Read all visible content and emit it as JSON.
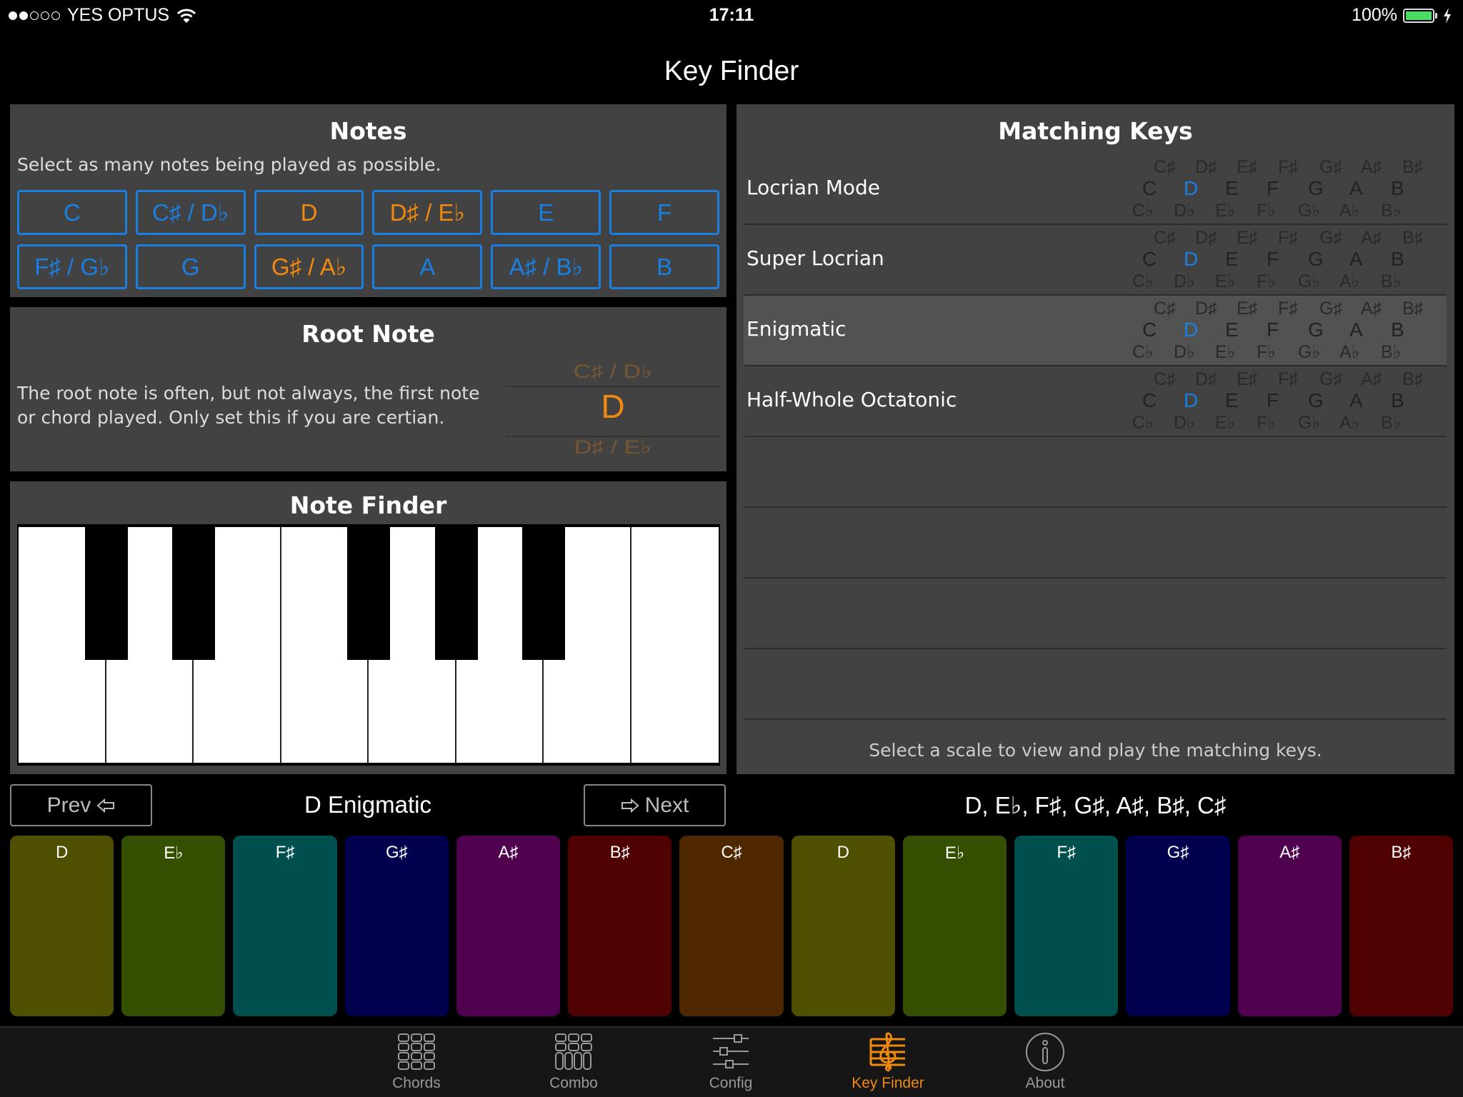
{
  "status_bar": {
    "signal_dots_filled": 2,
    "signal_dots_total": 5,
    "carrier": "YES OPTUS",
    "time": "17:11",
    "battery_percent": "100%",
    "battery_level": 1.0,
    "wifi_icon": "wifi-icon",
    "charging_icon": "bolt-icon"
  },
  "page_title": "Key Finder",
  "notes_panel": {
    "title": "Notes",
    "hint": "Select as many notes being played as possible.",
    "buttons": [
      {
        "label": "C",
        "selected": false
      },
      {
        "label": "C♯ / D♭",
        "selected": false
      },
      {
        "label": "D",
        "selected": true
      },
      {
        "label": "D♯ / E♭",
        "selected": true
      },
      {
        "label": "E",
        "selected": false
      },
      {
        "label": "F",
        "selected": false
      },
      {
        "label": "F♯ / G♭",
        "selected": false
      },
      {
        "label": "G",
        "selected": false
      },
      {
        "label": "G♯ / A♭",
        "selected": true
      },
      {
        "label": "A",
        "selected": false
      },
      {
        "label": "A♯ / B♭",
        "selected": false
      },
      {
        "label": "B",
        "selected": false
      }
    ]
  },
  "root_panel": {
    "title": "Root Note",
    "description": "The root note is often, but not always, the first note or chord played. Only set this if you are certian.",
    "picker": {
      "previous": "C♯ / D♭",
      "selected": "D",
      "next": "D♯ / E♭"
    }
  },
  "note_finder": {
    "title": "Note Finder",
    "white_keys": 8,
    "black_keys": 5
  },
  "matching_keys": {
    "title": "Matching Keys",
    "sharps": [
      "C♯",
      "D♯",
      "E♯",
      "F♯",
      "G♯",
      "A♯",
      "B♯"
    ],
    "naturals": [
      "C",
      "D",
      "E",
      "F",
      "G",
      "A",
      "B"
    ],
    "flats": [
      "C♭",
      "D♭",
      "E♭",
      "F♭",
      "G♭",
      "A♭",
      "B♭"
    ],
    "highlighted_natural": "D",
    "rows": [
      {
        "name": "Locrian Mode",
        "selected": false
      },
      {
        "name": "Super Locrian",
        "selected": false
      },
      {
        "name": "Enigmatic",
        "selected": true
      },
      {
        "name": "Half-Whole Octatonic",
        "selected": false
      }
    ],
    "empty_rows": 4,
    "hint": "Select a scale to view and play the matching keys."
  },
  "scale_nav": {
    "prev_label": "Prev",
    "prev_icon": "arrow-left-icon",
    "next_label": "Next",
    "next_icon": "arrow-right-icon",
    "scale_name": "D Enigmatic",
    "scale_notes": "D, E♭, F♯, G♯, A♯, B♯, C♯"
  },
  "pads": [
    {
      "label": "D",
      "color": "#4f4f00"
    },
    {
      "label": "E♭",
      "color": "#354f00"
    },
    {
      "label": "F♯",
      "color": "#004f4f"
    },
    {
      "label": "G♯",
      "color": "#00004f"
    },
    {
      "label": "A♯",
      "color": "#4f004f"
    },
    {
      "label": "B♯",
      "color": "#4f0000"
    },
    {
      "label": "C♯",
      "color": "#4f2800"
    },
    {
      "label": "D",
      "color": "#4f4f00"
    },
    {
      "label": "E♭",
      "color": "#354f00"
    },
    {
      "label": "F♯",
      "color": "#004f4f"
    },
    {
      "label": "G♯",
      "color": "#00004f"
    },
    {
      "label": "A♯",
      "color": "#4f004f"
    },
    {
      "label": "B♯",
      "color": "#4f0000"
    }
  ],
  "tabs": [
    {
      "label": "Chords",
      "icon": "chords-grid-icon",
      "active": false
    },
    {
      "label": "Combo",
      "icon": "combo-grid-icon",
      "active": false
    },
    {
      "label": "Config",
      "icon": "sliders-icon",
      "active": false
    },
    {
      "label": "Key Finder",
      "icon": "treble-clef-icon",
      "active": true
    },
    {
      "label": "About",
      "icon": "info-icon",
      "active": false
    }
  ],
  "colors": {
    "accent_blue": "#1a7fe0",
    "accent_orange": "#f0890f",
    "panel_bg": "#424242",
    "battery_green": "#4cd964"
  }
}
